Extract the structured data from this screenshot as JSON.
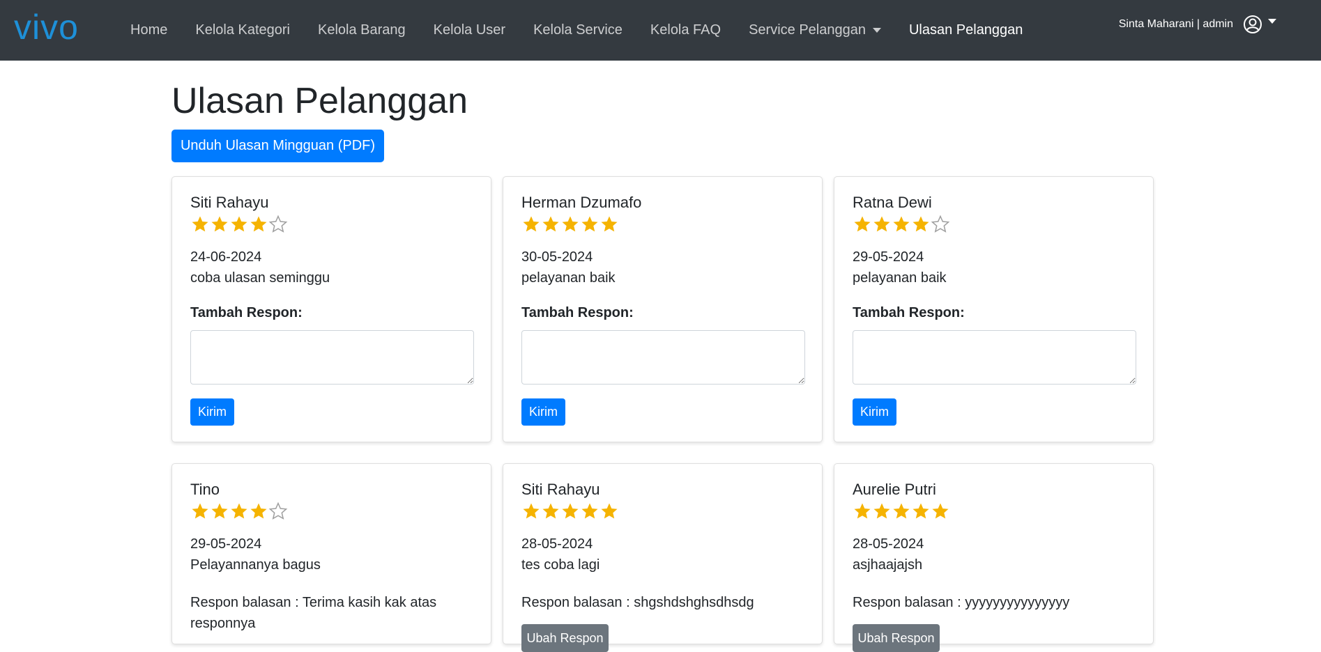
{
  "brand": {
    "logo_text": "vivo"
  },
  "nav": {
    "items": [
      {
        "label": "Home"
      },
      {
        "label": "Kelola Kategori"
      },
      {
        "label": "Kelola Barang"
      },
      {
        "label": "Kelola User"
      },
      {
        "label": "Kelola Service"
      },
      {
        "label": "Kelola FAQ"
      },
      {
        "label": "Service Pelanggan"
      },
      {
        "label": "Ulasan Pelanggan"
      }
    ],
    "user_text": "Sinta Maharani | admin"
  },
  "page": {
    "title": "Ulasan Pelanggan",
    "download_button": "Unduh Ulasan Mingguan (PDF)",
    "response_label": "Tambah Respon:",
    "send_label": "Kirim",
    "reply_prefix": "Respon balasan : ",
    "secondary_button": "Ubah Respon"
  },
  "colors": {
    "star": "#f5b301",
    "star_empty": "#9e9e9e",
    "primary": "#007bff",
    "navbar": "#343a40"
  },
  "reviews": [
    {
      "name": "Siti Rahayu",
      "rating": 4,
      "date": "24-06-2024",
      "text": "coba ulasan seminggu"
    },
    {
      "name": "Herman Dzumafo",
      "rating": 5,
      "date": "30-05-2024",
      "text": "pelayanan baik"
    },
    {
      "name": "Ratna Dewi",
      "rating": 4,
      "date": "29-05-2024",
      "text": "pelayanan baik"
    },
    {
      "name": "Tino",
      "rating": 4,
      "date": "29-05-2024",
      "text": "Pelayannanya bagus",
      "reply": "Respon balasan : Terima kasih kak atas responnya"
    },
    {
      "name": "Siti Rahayu",
      "rating": 5,
      "date": "28-05-2024",
      "text": "tes coba lagi",
      "reply": "Respon balasan : shgshdshghsdhsdg"
    },
    {
      "name": "Aurelie Putri",
      "rating": 5,
      "date": "28-05-2024",
      "text": "asjhaajajsh",
      "reply": "Respon balasan : yyyyyyyyyyyyyyy"
    }
  ]
}
